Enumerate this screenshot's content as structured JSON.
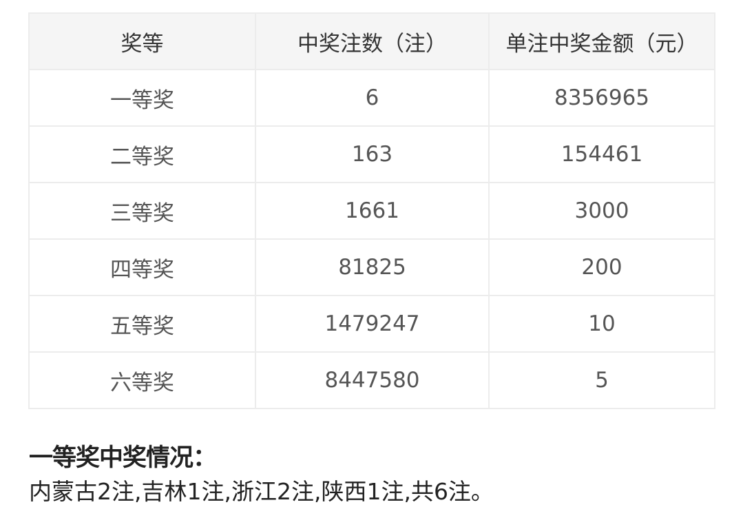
{
  "table": {
    "headers": [
      "奖等",
      "中奖注数（注）",
      "单注中奖金额（元）"
    ],
    "rows": [
      {
        "level": "一等奖",
        "count": "6",
        "amount": "8356965"
      },
      {
        "level": "二等奖",
        "count": "163",
        "amount": "154461"
      },
      {
        "level": "三等奖",
        "count": "1661",
        "amount": "3000"
      },
      {
        "level": "四等奖",
        "count": "81825",
        "amount": "200"
      },
      {
        "level": "五等奖",
        "count": "1479247",
        "amount": "10"
      },
      {
        "level": "六等奖",
        "count": "8447580",
        "amount": "5"
      }
    ]
  },
  "first_prize_section": {
    "heading": "一等奖中奖情况：",
    "text": "内蒙古2注,吉林1注,浙江2注,陕西1注,共6注。"
  }
}
